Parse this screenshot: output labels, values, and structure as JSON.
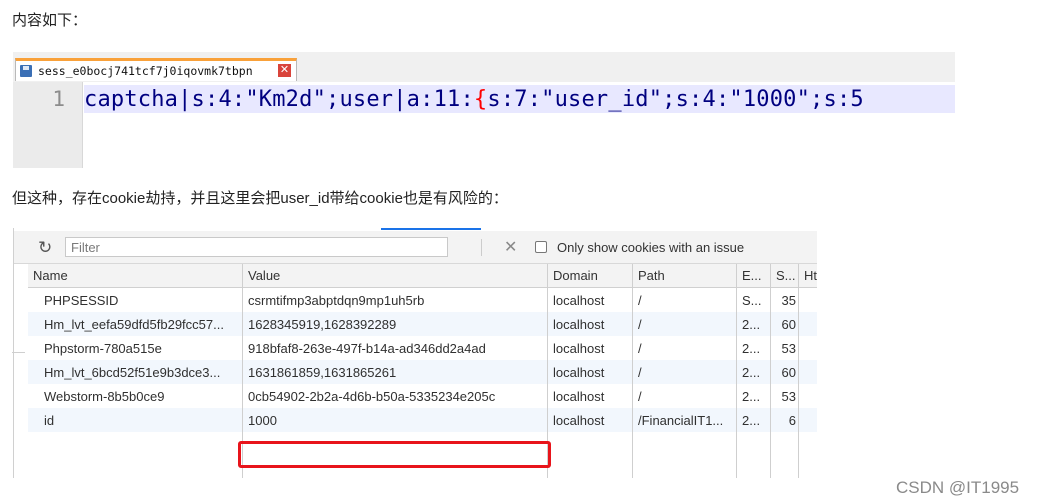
{
  "paragraph_1": "内容如下：",
  "editor": {
    "tab_name": "sess_e0bocj741tcf7j0iqovmk7tbpn",
    "line_number": "1",
    "code_before_brace": "captcha|s:4:\"Km2d\";user|a:11:",
    "code_brace": "{",
    "code_after_brace": "s:7:\"user_id\";s:4:\"1000\";s:5"
  },
  "paragraph_2": "但这种，存在cookie劫持，并且这里会把user_id带给cookie也是有风险的：",
  "devtools": {
    "filter_placeholder": "Filter",
    "only_issue_label": "Only show cookies with an issue",
    "columns": [
      "Name",
      "Value",
      "Domain",
      "Path",
      "E...",
      "S...",
      "Ht"
    ],
    "rows": [
      [
        "PHPSESSID",
        "csrmtifmp3abptdqn9mp1uh5rb",
        "localhost",
        "/",
        "S...",
        "35"
      ],
      [
        "Hm_lvt_eefa59dfd5fb29fcc57...",
        "1628345919,1628392289",
        "localhost",
        "/",
        "2...",
        "60"
      ],
      [
        "Phpstorm-780a515e",
        "918bfaf8-263e-497f-b14a-ad346dd2a4ad",
        "localhost",
        "/",
        "2...",
        "53"
      ],
      [
        "Hm_lvt_6bcd52f51e9b3dce3...",
        "1631861859,1631865261",
        "localhost",
        "/",
        "2...",
        "60"
      ],
      [
        "Webstorm-8b5b0ce9",
        "0cb54902-2b2a-4d6b-b50a-5335234e205c",
        "localhost",
        "/",
        "2...",
        "53"
      ],
      [
        "id",
        "1000",
        "localhost",
        "/FinancialIT1...",
        "2...",
        "6"
      ]
    ]
  },
  "watermark": "CSDN @IT1995",
  "colors": {
    "highlight": "#e8141b",
    "tab_accent": "#f9a13a",
    "code_text": "#000080"
  }
}
